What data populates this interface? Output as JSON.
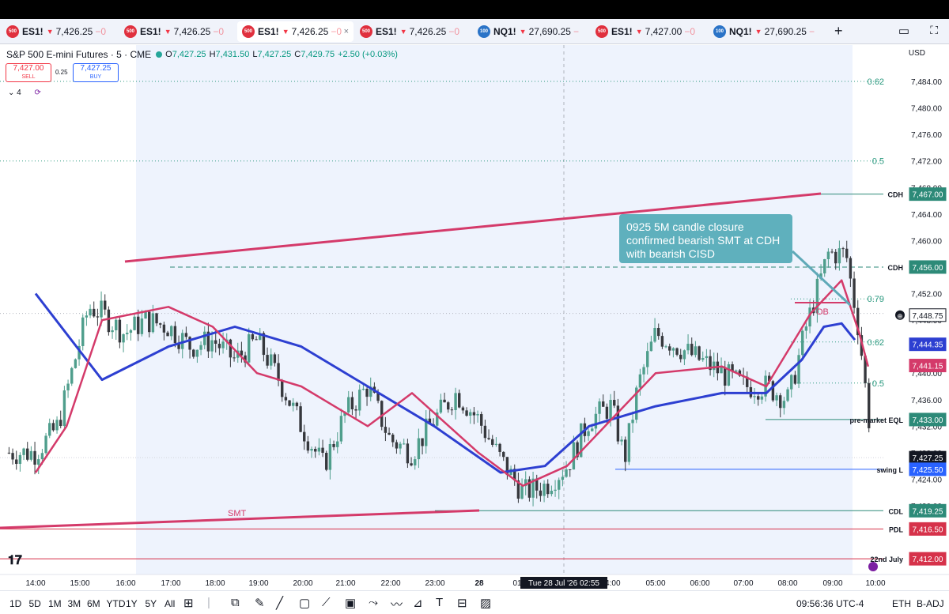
{
  "tabs": [
    {
      "badge": "500",
      "badge_color": "#e0303e",
      "symbol": "ES1!",
      "price": "7,426.25",
      "change": "−0",
      "active": false
    },
    {
      "badge": "500",
      "badge_color": "#e0303e",
      "symbol": "ES1!",
      "price": "7,426.25",
      "change": "−0",
      "active": false
    },
    {
      "badge": "500",
      "badge_color": "#e0303e",
      "symbol": "ES1!",
      "price": "7,426.25",
      "change": "−0",
      "active": true
    },
    {
      "badge": "500",
      "badge_color": "#e0303e",
      "symbol": "ES1!",
      "price": "7,426.25",
      "change": "−0",
      "active": false
    },
    {
      "badge": "100",
      "badge_color": "#2a73c7",
      "symbol": "NQ1!",
      "price": "27,690.25",
      "change": "−",
      "active": false
    },
    {
      "badge": "500",
      "badge_color": "#e0303e",
      "symbol": "ES1!",
      "price": "7,427.00",
      "change": "−0",
      "active": false
    },
    {
      "badge": "100",
      "badge_color": "#2a73c7",
      "symbol": "NQ1!",
      "price": "27,690.25",
      "change": "−",
      "active": false
    }
  ],
  "tab_close": "×",
  "add_tab": "+",
  "legend": {
    "title": "S&P 500 E-mini Futures · 5 · CME",
    "o_label": "O",
    "o": "7,427.25",
    "h_label": "H",
    "h": "7,431.50",
    "l_label": "L",
    "l": "7,427.25",
    "c_label": "C",
    "c": "7,429.75",
    "change": "+2.50 (+0.03%)"
  },
  "trade": {
    "sell_price": "7,427.00",
    "sell_label": "SELL",
    "spread": "0.25",
    "buy_price": "7,427.25",
    "buy_label": "BUY"
  },
  "indicators_count": "4",
  "currency": "USD",
  "chart_data": {
    "type": "candlestick",
    "ylim": [
      7416,
      7486
    ],
    "y_ticks": [
      "7,484.00",
      "7,480.00",
      "7,476.00",
      "7,472.00",
      "7,468.00",
      "7,464.00",
      "7,460.00",
      "7,456.00",
      "7,452.00",
      "7,448.00",
      "7,444.00",
      "7,440.00",
      "7,436.00",
      "7,432.00",
      "7,428.00",
      "7,424.00",
      "7,420.00"
    ],
    "x_ticks": [
      "14:00",
      "15:00",
      "16:00",
      "17:00",
      "18:00",
      "19:00",
      "20:00",
      "21:00",
      "22:00",
      "23:00",
      "28",
      "01:00",
      "02",
      "04:00",
      "05:00",
      "06:00",
      "07:00",
      "08:00",
      "09:00",
      "10:00"
    ],
    "crosshair_time": "Tue 28 Jul '26   02:55",
    "price_tags": [
      {
        "label": "CDH",
        "price": "7,467.00",
        "color": "#2d8a78",
        "value": 7467.0
      },
      {
        "label": "CDH",
        "price": "7,456.00",
        "color": "#2d8a78",
        "value": 7456.0
      },
      {
        "label": "",
        "price": "7,448.75",
        "color": "#131722",
        "value": 7448.75
      },
      {
        "label": "",
        "price": "7,444.35",
        "color": "#2d3fd1",
        "value": 7444.35
      },
      {
        "label": "",
        "price": "7,441.15",
        "color": "#d43a6a",
        "value": 7441.15
      },
      {
        "label": "pre-market EQL",
        "price": "7,433.00",
        "color": "#2d8a78",
        "value": 7433.0
      },
      {
        "label": "",
        "price": "7,427.25",
        "color": "#131722",
        "value": 7427.25,
        "countdown": "03:23"
      },
      {
        "label": "swing L",
        "price": "7,425.50",
        "color": "#2962ff",
        "value": 7425.5
      },
      {
        "label": "CDL",
        "price": "7,419.25",
        "color": "#2d8a78",
        "value": 7419.25
      },
      {
        "label": "PDL",
        "price": "7,416.50",
        "color": "#d6324a",
        "value": 7416.5
      },
      {
        "label": "22nd July",
        "price": "7,412.00",
        "color": "#d6324a",
        "value": 7412.0
      }
    ],
    "fib_levels": [
      {
        "label": "0.62",
        "value": 7484.0
      },
      {
        "label": "0.5",
        "value": 7472.0
      },
      {
        "label": "0.79",
        "value": 7451.2
      },
      {
        "label": "0.62",
        "value": 7444.7
      },
      {
        "label": "0.5",
        "value": 7438.5
      }
    ],
    "annotations": {
      "callout": "0925 5M candle closure confirmed bearish SMT at CDH with bearish CISD",
      "smt": "SMT",
      "ob": "OB"
    },
    "series": [
      {
        "name": "",
        "color": "#2d3fd1",
        "points": [
          [
            0,
            7452
          ],
          [
            1.5,
            7439
          ],
          [
            3,
            7444
          ],
          [
            4.5,
            7447
          ],
          [
            6,
            7444
          ],
          [
            7.5,
            7438
          ],
          [
            9,
            7432
          ],
          [
            10.5,
            7425
          ],
          [
            11.5,
            7426
          ],
          [
            12.5,
            7432
          ],
          [
            14,
            7435
          ],
          [
            15.5,
            7437
          ],
          [
            16.5,
            7437
          ],
          [
            17.3,
            7442
          ],
          [
            17.8,
            7447
          ],
          [
            18.2,
            7447.5
          ],
          [
            18.5,
            7445
          ]
        ]
      },
      {
        "name": "",
        "color": "#d43a6a",
        "points": [
          [
            0,
            7425
          ],
          [
            0.7,
            7432
          ],
          [
            1.5,
            7448
          ],
          [
            3,
            7450
          ],
          [
            4,
            7447
          ],
          [
            5,
            7440
          ],
          [
            6,
            7438
          ],
          [
            7.5,
            7432
          ],
          [
            8.5,
            7437
          ],
          [
            10,
            7428
          ],
          [
            11,
            7423
          ],
          [
            12,
            7426
          ],
          [
            13,
            7433
          ],
          [
            14,
            7440
          ],
          [
            15.5,
            7441
          ],
          [
            16.5,
            7438
          ],
          [
            17.5,
            7449
          ],
          [
            18.2,
            7454
          ],
          [
            18.6,
            7446
          ],
          [
            18.8,
            7441
          ]
        ]
      }
    ],
    "candles_note": "OHLC at 5-minute intervals; values in price units"
  },
  "bottom": {
    "ranges": [
      "1D",
      "5D",
      "1M",
      "3M",
      "6M",
      "YTD",
      "1Y",
      "5Y",
      "All"
    ],
    "clock": "09:56:36 UTC-4",
    "session": "ETH",
    "adjustment": "B-ADJ"
  }
}
